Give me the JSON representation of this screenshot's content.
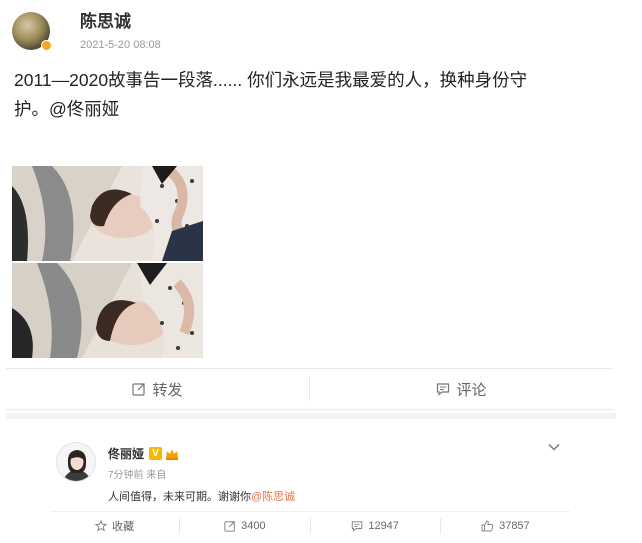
{
  "post": {
    "author": "陈思诚",
    "time": "2021-5-20 08:08",
    "text_line1": "2011—2020故事告一段落...... 你们永远是我最爱的人，换种身份守",
    "text_line2": "护。",
    "mention": "@佟丽娅",
    "actions": {
      "repost": "转发",
      "comment": "评论"
    }
  },
  "repost": {
    "author": "佟丽娅",
    "time": "7分钟前 来自",
    "text": "人间值得，未来可期。谢谢你",
    "mention": "@陈思诚",
    "v_badge": "V",
    "actions": {
      "favorite": "收藏",
      "repost_count": "3400",
      "comment_count": "12947",
      "like_count": "37857"
    }
  },
  "colors": {
    "mention": "#eb7350",
    "badge": "#f6b800"
  }
}
